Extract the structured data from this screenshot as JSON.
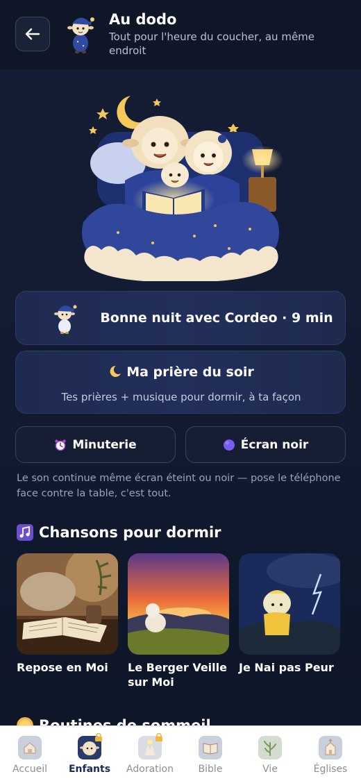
{
  "header": {
    "title": "Au dodo",
    "subtitle": "Tout pour l'heure du coucher, au même endroit"
  },
  "cards": {
    "cordeo_label": "Bonne nuit avec Cordeo · 9 min",
    "priere_title": "Ma prière du soir",
    "priere_subtitle": "Tes prières + musique pour dormir, à ta façon"
  },
  "buttons": {
    "timer_label": "Minuterie",
    "black_screen_label": "Écran noir"
  },
  "note": "Le son continue même écran éteint ou noir — pose le téléphone face contre la table, c'est tout.",
  "songs_section": {
    "title": "Chansons pour dormir",
    "items": [
      {
        "title": "Repose en Moi"
      },
      {
        "title": "Le Berger Veille sur Moi"
      },
      {
        "title": "Je Nai pas Peur"
      }
    ]
  },
  "next_section": {
    "title": "Routines de sommeil"
  },
  "nav": {
    "items": [
      {
        "label": "Accueil",
        "icon": "home-icon"
      },
      {
        "label": "Enfants",
        "icon": "sheep-icon"
      },
      {
        "label": "Adoration",
        "icon": "praise-icon"
      },
      {
        "label": "Bible",
        "icon": "book-icon"
      },
      {
        "label": "Vie",
        "icon": "leaf-icon"
      },
      {
        "label": "Églises",
        "icon": "church-icon"
      }
    ],
    "active": "Enfants"
  },
  "colors": {
    "background": "#131c33",
    "card": "#222f5a",
    "accent": "#7b5cf0",
    "nav_active": "#1a2a5a"
  }
}
